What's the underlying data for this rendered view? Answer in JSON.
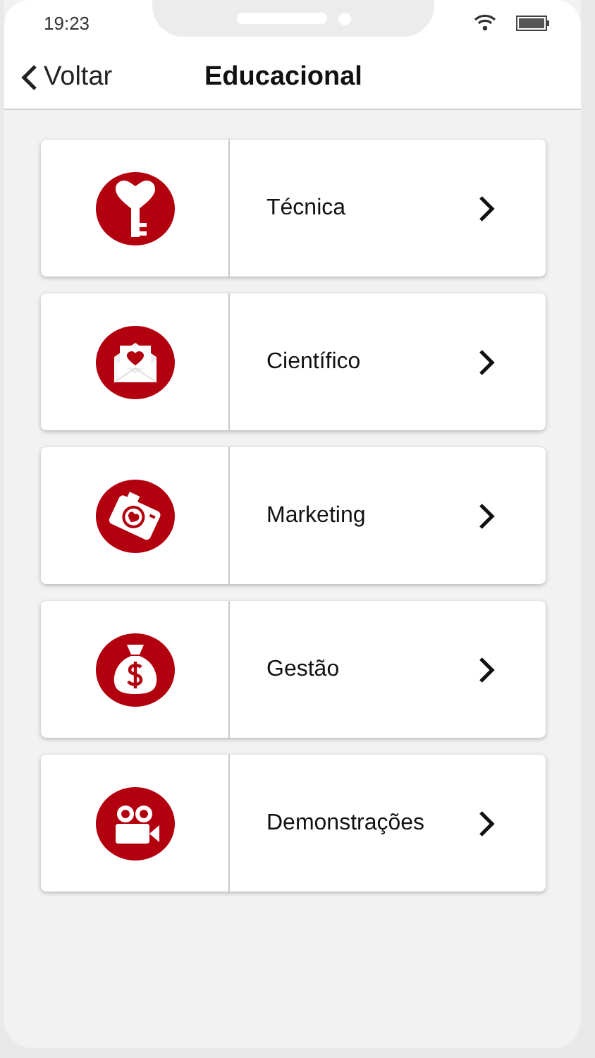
{
  "status_bar": {
    "time": "19:23"
  },
  "nav": {
    "back": "Voltar",
    "title": "Educacional"
  },
  "items": [
    {
      "kind": "key",
      "label": "Técnica"
    },
    {
      "kind": "mail",
      "label": "Científico"
    },
    {
      "kind": "camera",
      "label": "Marketing"
    },
    {
      "kind": "money",
      "label": "Gestão"
    },
    {
      "kind": "video",
      "label": "Demonstrações"
    }
  ]
}
